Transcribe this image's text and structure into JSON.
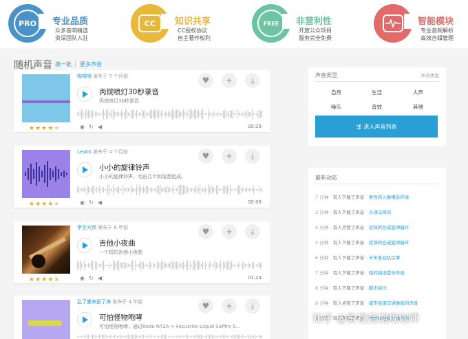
{
  "features": [
    {
      "badge": "PRO",
      "title": "专业品质",
      "lines": [
        "众多音响精选",
        "资深团队入驻"
      ],
      "color": "#4a93c9"
    },
    {
      "badge": "CC",
      "title": "知识共享",
      "lines": [
        "CC授权协议",
        "自主著作权利"
      ],
      "color": "#e8b83a"
    },
    {
      "badge": "FREE",
      "title": "非营利性",
      "lines": [
        "开放公众项目",
        "服务完全免费"
      ],
      "color": "#6cc4a4"
    },
    {
      "badge": "pulse-icon",
      "title": "智能模块",
      "lines": [
        "专业音频解析",
        "高效合辑管理"
      ],
      "color": "#e36a6a"
    }
  ],
  "section": {
    "title": "随机声音",
    "link_shuffle": "换一批",
    "separator": "|",
    "link_more": "更多声音"
  },
  "sounds": [
    {
      "user": "喵喵喵",
      "posted": "发布于 7 个月前",
      "title": "丙烷喷灯30秒录音",
      "desc": "丙烷喷灯30秒录音",
      "duration": "00:29",
      "rating": 4,
      "thumb_color": "#7fc7e8"
    },
    {
      "user": "LesKK",
      "posted": "发布于 4 个月前",
      "title": "小小的旋律铃声",
      "desc": "小小的旋律铃声，宅由几个和弦音组成。",
      "duration": "00:08",
      "rating": 4,
      "thumb_color": "#9a82e8"
    },
    {
      "user": "李生大邦",
      "posted": "发布于 6 年前",
      "title": "吉他小夜曲",
      "desc": "一个短的吉他小夜曲",
      "duration": "01:24",
      "rating": 4.5,
      "thumb_color": "#4a2a14"
    },
    {
      "user": "乱了夏来是了海",
      "posted": "发布于 4 年前",
      "title": "可怕怪物咆哮",
      "desc": "可怕怪物咆哮，通过Rode NT2A > Focusrite Liquid Saffire 5...",
      "duration": "",
      "rating": 0,
      "thumb_color": "#b5a8f0"
    }
  ],
  "types_panel": {
    "title": "声音类型",
    "subtitle": "所有类型",
    "categories": [
      "自然",
      "生活",
      "人声",
      "噪乐",
      "音效",
      "其他"
    ],
    "enter_button": "进入声音列表"
  },
  "activity": {
    "title": "最新动态",
    "items": [
      {
        "time": "7 分钟",
        "action": "有人下载了声音",
        "name": "男性的入静噶杂环境"
      },
      {
        "time": "3 分钟",
        "action": "有人下载了声音",
        "name": "卡通马保鸡"
      },
      {
        "time": "4 分钟",
        "action": "有人点赞了声音",
        "name": "欢快的合成旋律循环"
      },
      {
        "time": "4 分钟",
        "action": "有人下载了声音",
        "name": "欢快的合成旋律循环"
      },
      {
        "time": "6 分钟",
        "action": "有人下载了声音",
        "name": "卡车发动机引擎"
      },
      {
        "time": "7 分钟",
        "action": "有人下载了声音",
        "name": "短的错误提示声音"
      },
      {
        "time": "8 分钟",
        "action": "有人下载了声音",
        "name": "脚步经过"
      },
      {
        "time": "8 分钟",
        "action": "有人点赞了声音",
        "name": "城市街道交通噪音的声音"
      },
      {
        "time": "8 分钟",
        "action": "有人下载了声音",
        "name": "咆哮衔招我书籍资料"
      }
    ]
  },
  "watermark": "知乎 @影视后期规划师"
}
